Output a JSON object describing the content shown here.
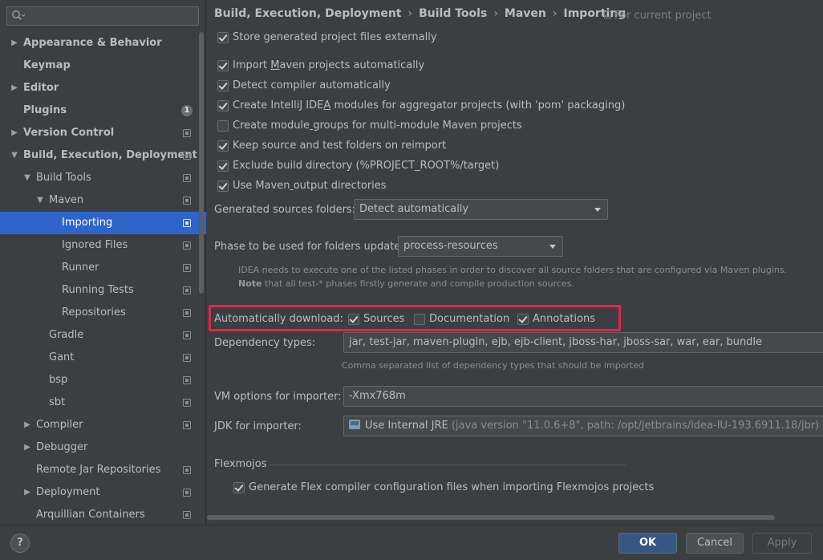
{
  "search": {
    "placeholder": "",
    "value": ""
  },
  "sidebar": {
    "items": [
      {
        "label": "Appearance & Behavior",
        "arrow": "▶",
        "bold": true
      },
      {
        "label": "Keymap",
        "bold": true
      },
      {
        "label": "Editor",
        "arrow": "▶",
        "bold": true
      },
      {
        "label": "Plugins",
        "bold": true,
        "badge": "1"
      },
      {
        "label": "Version Control",
        "arrow": "▶",
        "bold": true
      },
      {
        "label": "Build, Execution, Deployment",
        "arrow": "▼",
        "bold": true
      },
      {
        "label": "Build Tools",
        "arrow": "▼"
      },
      {
        "label": "Maven",
        "arrow": "▼"
      },
      {
        "label": "Importing"
      },
      {
        "label": "Ignored Files"
      },
      {
        "label": "Runner"
      },
      {
        "label": "Running Tests"
      },
      {
        "label": "Repositories"
      },
      {
        "label": "Gradle"
      },
      {
        "label": "Gant"
      },
      {
        "label": "bsp"
      },
      {
        "label": "sbt"
      },
      {
        "label": "Compiler",
        "arrow": "▶"
      },
      {
        "label": "Debugger",
        "arrow": "▶"
      },
      {
        "label": "Remote Jar Repositories"
      },
      {
        "label": "Deployment",
        "arrow": "▶"
      },
      {
        "label": "Arquillian Containers"
      }
    ]
  },
  "breadcrumb": {
    "items": [
      "Build, Execution, Deployment",
      "Build Tools",
      "Maven",
      "Importing"
    ],
    "separator": "›",
    "for_project": "For current project"
  },
  "options": {
    "store_external": {
      "label": "Store generated project files externally",
      "checked": true
    },
    "import_auto": {
      "label_pre": "Import ",
      "label_u": "M",
      "label_post": "aven projects automatically",
      "checked": true
    },
    "detect_compiler": {
      "label": "Detect compiler automatically",
      "checked": true
    },
    "create_modules": {
      "label_pre": "Create IntelliJ IDE",
      "label_u": "A",
      "label_post": " modules for aggregator projects (with 'pom' packaging)",
      "checked": true
    },
    "module_groups": {
      "label_pre": "Create module",
      "label_u": " ",
      "label_post": "groups for multi-module Maven projects",
      "checked": false
    },
    "keep_source": {
      "label": "Keep source and test folders on reimport",
      "checked": true
    },
    "exclude_build": {
      "label": "Exclude build directory (%PROJECT_ROOT%/target)",
      "checked": true
    },
    "use_output": {
      "label_pre": "Use Maven",
      "label_u": " ",
      "label_post": "output directories",
      "checked": true
    }
  },
  "generated_sources": {
    "label": "Generated sources folders:",
    "value": "Detect automatically"
  },
  "phase": {
    "label": "Phase to be used for folders update:",
    "value": "process-resources",
    "hint_line1": "IDEA needs to execute one of the listed phases in order to discover all source folders that are configured via Maven plugins.",
    "hint_note": "Note",
    "hint_line2": " that all test-* phases firstly generate and compile production sources."
  },
  "auto_download": {
    "label": "Automatically download:",
    "sources": {
      "label": "Sources",
      "checked": true
    },
    "documentation": {
      "label": "Documentation",
      "checked": false
    },
    "annotations": {
      "label": "Annotations",
      "checked": true
    }
  },
  "dependency_types": {
    "label": "Dependency types:",
    "value": "jar, test-jar, maven-plugin, ejb, ejb-client, jboss-har, jboss-sar, war, ear, bundle",
    "hint": "Comma separated list of dependency types that should be imported"
  },
  "vm_options": {
    "label": "VM options for importer:",
    "value": "-Xmx768m"
  },
  "jdk": {
    "label": "JDK for importer:",
    "value": "Use Internal JRE",
    "detail": " (java version \"11.0.6+8\", path: /opt/jetbrains/idea-IU-193.6911.18/jbr)"
  },
  "flexmojos": {
    "title": "Flexmojos",
    "generate": {
      "label": "Generate Flex compiler configuration files when importing Flexmojos projects",
      "checked": true
    }
  },
  "footer": {
    "help": "?",
    "ok": "OK",
    "cancel": "Cancel",
    "apply": "Apply"
  }
}
